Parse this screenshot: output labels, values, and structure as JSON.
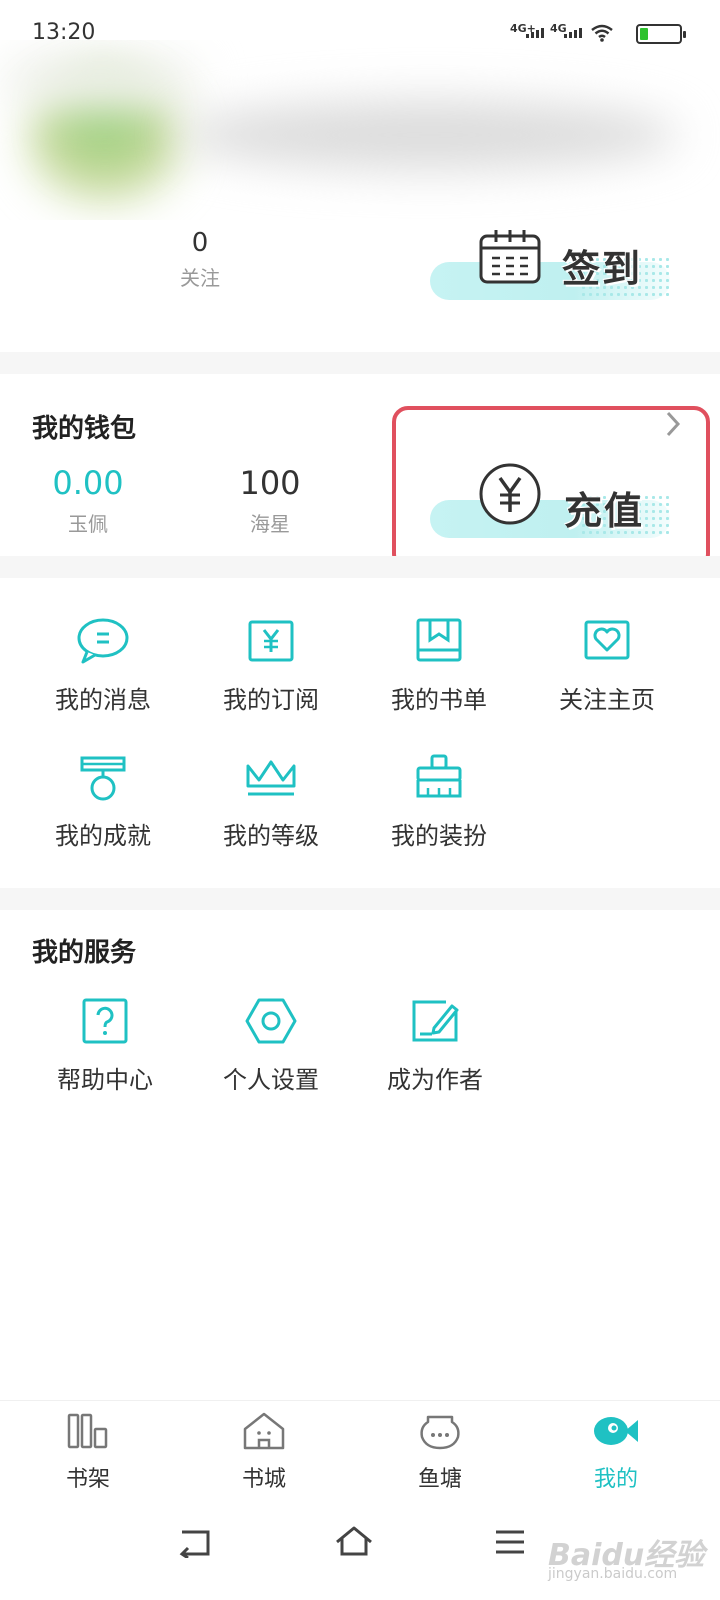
{
  "status_bar": {
    "time": "13:20",
    "network_1": "4G+",
    "network_2": "4G"
  },
  "profile": {
    "follow_count": "0",
    "follow_label": "关注",
    "checkin_label": "签到"
  },
  "wallet": {
    "title": "我的钱包",
    "jade_value": "0.00",
    "jade_label": "玉佩",
    "starfish_value": "100",
    "starfish_label": "海星",
    "recharge_label": "充值"
  },
  "menu": {
    "items": [
      {
        "label": "我的消息",
        "icon": "chat-bubble-icon"
      },
      {
        "label": "我的订阅",
        "icon": "yen-book-icon"
      },
      {
        "label": "我的书单",
        "icon": "bookmark-book-icon"
      },
      {
        "label": "关注主页",
        "icon": "heart-card-icon"
      },
      {
        "label": "我的成就",
        "icon": "medal-icon"
      },
      {
        "label": "我的等级",
        "icon": "crown-icon"
      },
      {
        "label": "我的装扮",
        "icon": "brush-icon"
      }
    ]
  },
  "services": {
    "title": "我的服务",
    "items": [
      {
        "label": "帮助中心",
        "icon": "help-icon"
      },
      {
        "label": "个人设置",
        "icon": "settings-hex-icon"
      },
      {
        "label": "成为作者",
        "icon": "write-icon"
      }
    ]
  },
  "tabs": [
    {
      "label": "书架",
      "icon": "bookshelf-icon"
    },
    {
      "label": "书城",
      "icon": "bookstore-icon"
    },
    {
      "label": "鱼塘",
      "icon": "fishpond-icon"
    },
    {
      "label": "我的",
      "icon": "fish-icon",
      "active": true
    }
  ],
  "watermark": {
    "text": "Baidu经验",
    "sub": "jingyan.baidu.com"
  },
  "colors": {
    "accent": "#1fc1c3",
    "highlight": "#e0505e"
  }
}
